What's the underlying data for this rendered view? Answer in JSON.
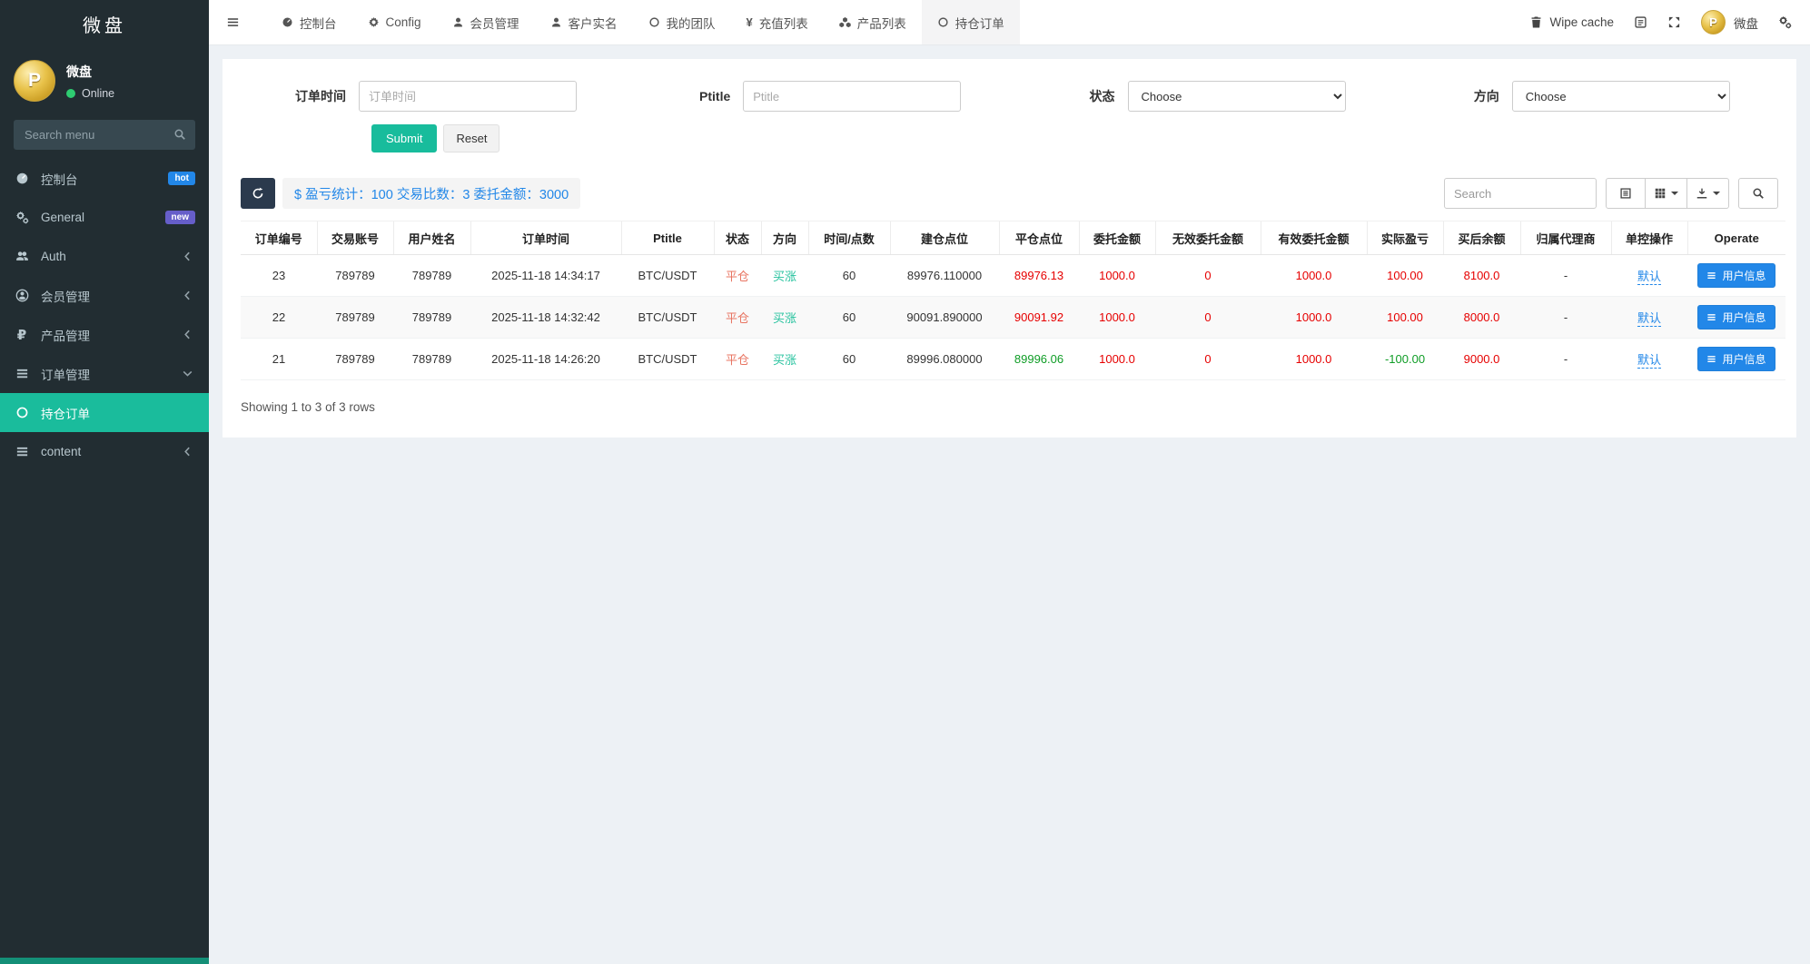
{
  "colors": {
    "accent": "#18bc9c",
    "red": "#e60000",
    "green": "#0f9d26",
    "blue": "#2287e8",
    "salmon": "#e87461",
    "teal": "#26c29e"
  },
  "sidebar": {
    "brand": "微盘",
    "user": {
      "name": "微盘",
      "status": "Online",
      "avatar_letter": "P"
    },
    "search_placeholder": "Search menu",
    "items": [
      {
        "id": "console",
        "label": "控制台",
        "icon": "dashboard-icon",
        "badge": "hot"
      },
      {
        "id": "general",
        "label": "General",
        "icon": "gears-icon",
        "badge": "new"
      },
      {
        "id": "auth",
        "label": "Auth",
        "icon": "users-icon",
        "chevron": "left"
      },
      {
        "id": "members",
        "label": "会员管理",
        "icon": "user-circle-icon",
        "chevron": "left"
      },
      {
        "id": "products",
        "label": "产品管理",
        "icon": "ruble-icon",
        "chevron": "left"
      },
      {
        "id": "orders",
        "label": "订单管理",
        "icon": "list-icon",
        "chevron": "down"
      },
      {
        "id": "position-orders",
        "label": "持仓订单",
        "icon": "circle-icon",
        "active": true
      },
      {
        "id": "content",
        "label": "content",
        "icon": "list-icon",
        "chevron": "left"
      }
    ]
  },
  "navbar": {
    "tabs": [
      {
        "id": "console",
        "label": "控制台",
        "icon": "dashboard-icon"
      },
      {
        "id": "config",
        "label": "Config",
        "icon": "gear-icon"
      },
      {
        "id": "members",
        "label": "会员管理",
        "icon": "user-icon"
      },
      {
        "id": "realname",
        "label": "客户实名",
        "icon": "user-icon"
      },
      {
        "id": "team",
        "label": "我的团队",
        "icon": "circle-icon"
      },
      {
        "id": "recharge",
        "label": "充值列表",
        "icon": "yen-icon"
      },
      {
        "id": "product-list",
        "label": "产品列表",
        "icon": "cubes-icon"
      },
      {
        "id": "position-orders",
        "label": "持仓订单",
        "icon": "circle-icon",
        "active": true
      }
    ],
    "wipe_cache": "Wipe cache",
    "user_name": "微盘",
    "user_avatar_letter": "P"
  },
  "filters": {
    "order_time": {
      "label": "订单时间",
      "placeholder": "订单时间",
      "value": ""
    },
    "ptitle": {
      "label": "Ptitle",
      "placeholder": "Ptitle",
      "value": ""
    },
    "status": {
      "label": "状态",
      "selected": "Choose"
    },
    "direction": {
      "label": "方向",
      "selected": "Choose"
    },
    "submit_label": "Submit",
    "reset_label": "Reset"
  },
  "toolbar": {
    "stats": "$ 盈亏统计：100 交易比数：3 委托金额：3000",
    "search_placeholder": "Search"
  },
  "table": {
    "columns": [
      "订单编号",
      "交易账号",
      "用户姓名",
      "订单时间",
      "Ptitle",
      "状态",
      "方向",
      "时间/点数",
      "建仓点位",
      "平仓点位",
      "委托金额",
      "无效委托金额",
      "有效委托金额",
      "实际盈亏",
      "买后余额",
      "归属代理商",
      "单控操作",
      "Operate"
    ],
    "rows": [
      {
        "order_id": "23",
        "account": "789789",
        "username": "789789",
        "order_time": "2025-11-18 14:34:17",
        "ptitle": "BTC/USDT",
        "status": "平仓",
        "direction": "买涨",
        "period": "60",
        "open_point": "89976.110000",
        "close_point": "89976.13",
        "close_color": "red",
        "entrust": "1000.0",
        "invalid_entrust": "0",
        "valid_entrust": "1000.0",
        "profit": "100.00",
        "profit_color": "red",
        "balance": "8100.0",
        "agent": "-",
        "control": "默认",
        "operate": "用户信息"
      },
      {
        "order_id": "22",
        "account": "789789",
        "username": "789789",
        "order_time": "2025-11-18 14:32:42",
        "ptitle": "BTC/USDT",
        "status": "平仓",
        "direction": "买涨",
        "period": "60",
        "open_point": "90091.890000",
        "close_point": "90091.92",
        "close_color": "red",
        "entrust": "1000.0",
        "invalid_entrust": "0",
        "valid_entrust": "1000.0",
        "profit": "100.00",
        "profit_color": "red",
        "balance": "8000.0",
        "agent": "-",
        "control": "默认",
        "operate": "用户信息"
      },
      {
        "order_id": "21",
        "account": "789789",
        "username": "789789",
        "order_time": "2025-11-18 14:26:20",
        "ptitle": "BTC/USDT",
        "status": "平仓",
        "direction": "买涨",
        "period": "60",
        "open_point": "89996.080000",
        "close_point": "89996.06",
        "close_color": "green",
        "entrust": "1000.0",
        "invalid_entrust": "0",
        "valid_entrust": "1000.0",
        "profit": "-100.00",
        "profit_color": "green",
        "balance": "9000.0",
        "agent": "-",
        "control": "默认",
        "operate": "用户信息"
      }
    ],
    "summary": "Showing 1 to 3 of 3 rows"
  }
}
